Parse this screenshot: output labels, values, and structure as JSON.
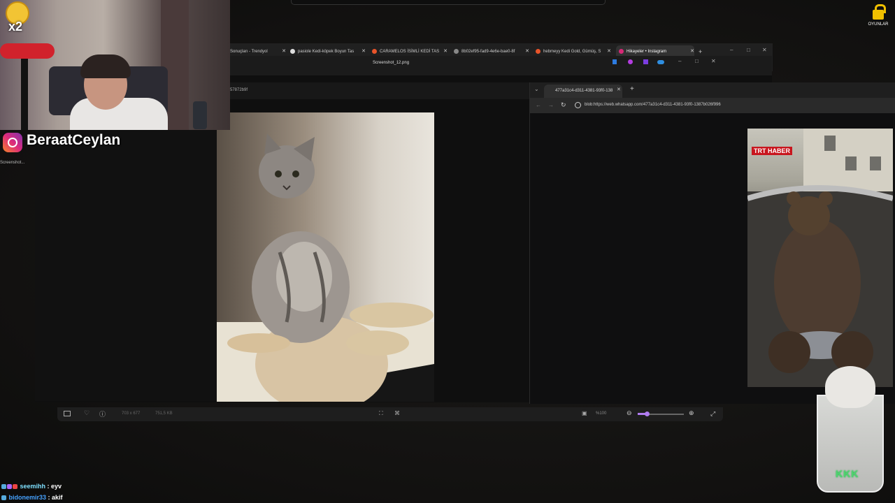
{
  "stream": {
    "streamer_name": "BeraatCeylan",
    "multiplier": "x2",
    "desktop_icon_label": "Screenshot...",
    "games_label": "OYUNLAR"
  },
  "browser": {
    "tabs": [
      {
        "label": "Sonuçları - Trendyol"
      },
      {
        "label": "pasiole Kedi-köpek Boyun Tas"
      },
      {
        "label": "CARAMELOS İSİMLİ KEDİ TAS"
      },
      {
        "label": "8b02ef95-fad9-4e6e-bae0-8f"
      },
      {
        "label": "hebmeyy Kedi Gold, Gümüş, S"
      },
      {
        "label": "Hikayeler • Instagram"
      }
    ],
    "new_tab": "+"
  },
  "viewer": {
    "title": "Screenshot_12.png",
    "path_fragment": "57872b9f",
    "dimensions": "703 x 677",
    "filesize": "751,5 KB",
    "zoom": "%100"
  },
  "blob_window": {
    "tab_label": "477a31c4-d311-4381-93f0-138",
    "url": "blob:https://web.whatsapp.com/477a31c4-d311-4381-93f0-1387b026f996",
    "watermark": "TRT HABER"
  },
  "chat": [
    {
      "user": "seemihh",
      "message": "eyv"
    },
    {
      "user": "bidonemir33",
      "message": "akif"
    }
  ],
  "overlay": {
    "cup_text": "KKK"
  }
}
